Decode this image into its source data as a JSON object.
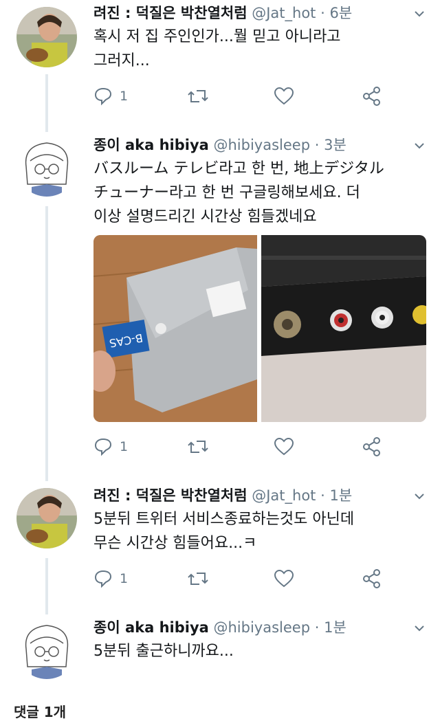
{
  "tweets": [
    {
      "name": "려진 : 덕질은 박찬열처럼",
      "handle": "@Jat_hot",
      "separator": "·",
      "time": "6분",
      "lines": [
        "혹시 저 집 주인인가...뭘 믿고 아니라고",
        "그러지..."
      ],
      "reply_count": "1"
    },
    {
      "name": "종이 aka hibiya",
      "handle": "@hibiyasleep",
      "separator": "·",
      "time": "3분",
      "lines": [
        "バスルーム テレビ라고 한 번, 地上デジタル",
        "チューナー라고 한 번 구글링해보세요. 더",
        "이상 설명드리긴 시간상 힘들겠네요"
      ],
      "reply_count": "1",
      "media": {
        "left_card_text": "B-CAS",
        "left_label": "device-box-photo",
        "right_label": "device-ports-photo"
      }
    },
    {
      "name": "려진 : 덕질은 박찬열처럼",
      "handle": "@Jat_hot",
      "separator": "·",
      "time": "1분",
      "lines": [
        "5분뒤 트위터 서비스종료하는것도 아닌데",
        "무슨 시간상 힘들어요...ㅋ"
      ],
      "reply_count": "1"
    },
    {
      "name": "종이 aka hibiya",
      "handle": "@hibiyasleep",
      "separator": "·",
      "time": "1분",
      "lines": [
        "5분뒤 출근하니까요..."
      ]
    }
  ],
  "footer": {
    "label": "댓글 1개"
  },
  "icons": {
    "reply": "reply-icon",
    "retweet": "retweet-icon",
    "like": "heart-icon",
    "share": "share-icon",
    "more": "chevron-down-icon"
  },
  "colors": {
    "text": "#14171a",
    "muted": "#657786",
    "thread_line": "#e1e8ed"
  }
}
